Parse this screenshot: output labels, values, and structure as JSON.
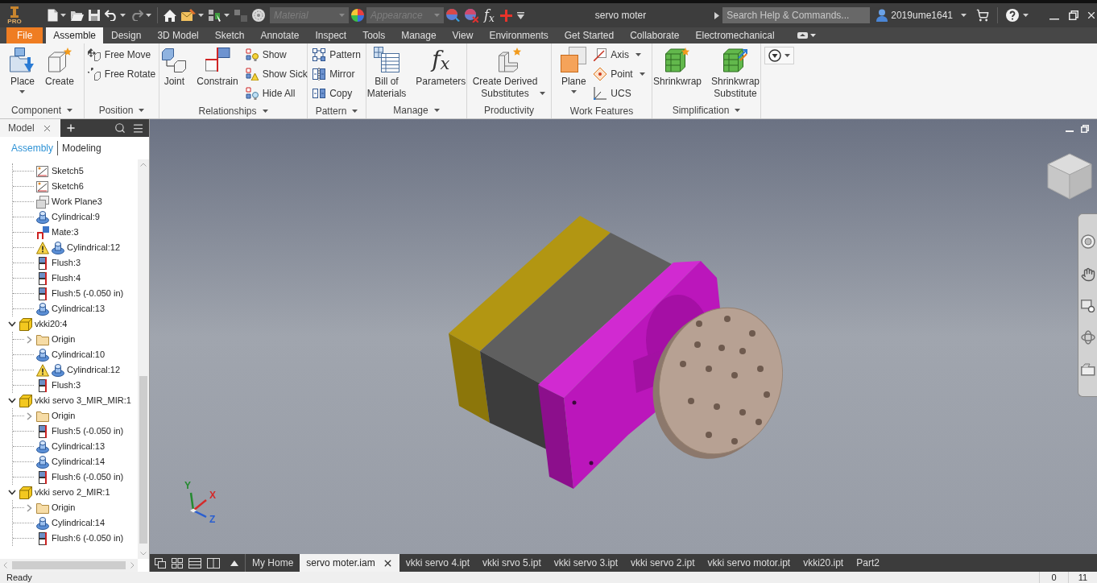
{
  "title_bar": {
    "logo_badge": "PRO",
    "material_field": {
      "placeholder": "Material",
      "disabled": true
    },
    "appearance_field": {
      "placeholder": "Appearance",
      "disabled": true
    },
    "formula_symbol": "f$_{x}$",
    "title": "servo moter",
    "search": {
      "placeholder": "Search Help & Commands..."
    },
    "user": "2019ume1641"
  },
  "ribbon": {
    "tabs": [
      {
        "label": "File",
        "kind": "file",
        "selected": false
      },
      {
        "label": "Assemble",
        "kind": "tab",
        "selected": true
      },
      {
        "label": "Design",
        "kind": "tab",
        "selected": false
      },
      {
        "label": "3D Model",
        "kind": "tab",
        "selected": false
      },
      {
        "label": "Sketch",
        "kind": "tab",
        "selected": false
      },
      {
        "label": "Annotate",
        "kind": "tab",
        "selected": false
      },
      {
        "label": "Inspect",
        "kind": "tab",
        "selected": false
      },
      {
        "label": "Tools",
        "kind": "tab",
        "selected": false
      },
      {
        "label": "Manage",
        "kind": "tab",
        "selected": false
      },
      {
        "label": "View",
        "kind": "tab",
        "selected": false
      },
      {
        "label": "Environments",
        "kind": "tab",
        "selected": false
      },
      {
        "label": "Get Started",
        "kind": "tab",
        "selected": false
      },
      {
        "label": "Collaborate",
        "kind": "tab",
        "selected": false
      },
      {
        "label": "Electromechanical",
        "kind": "tab",
        "selected": false
      }
    ],
    "panels": [
      {
        "title": "Component",
        "has_menu": true,
        "tools": [
          {
            "label": "Place",
            "kind": "large",
            "has_menu": true
          },
          {
            "label": "Create",
            "kind": "large",
            "has_menu": false
          }
        ]
      },
      {
        "title": "Position",
        "has_menu": true,
        "tools": [
          {
            "label": "Free Move",
            "kind": "small",
            "has_menu": false
          },
          {
            "label": "Free Rotate",
            "kind": "small",
            "has_menu": false
          }
        ]
      },
      {
        "title": "Relationships",
        "has_menu": true,
        "tools": [
          {
            "label": "Joint",
            "kind": "large",
            "has_menu": false
          },
          {
            "label": "Constrain",
            "kind": "large",
            "has_menu": false
          },
          {
            "label": "Show",
            "kind": "small",
            "has_menu": false
          },
          {
            "label": "Show Sick",
            "kind": "small",
            "has_menu": false
          },
          {
            "label": "Hide All",
            "kind": "small",
            "has_menu": false
          }
        ]
      },
      {
        "title": "Pattern",
        "has_menu": true,
        "tools": [
          {
            "label": "Pattern",
            "kind": "small",
            "has_menu": false
          },
          {
            "label": "Mirror",
            "kind": "small",
            "has_menu": false
          },
          {
            "label": "Copy",
            "kind": "small",
            "has_menu": false
          }
        ]
      },
      {
        "title": "Manage",
        "has_menu": true,
        "tools": [
          {
            "label": "Bill of\nMaterials",
            "kind": "large",
            "has_menu": false
          },
          {
            "label": "Parameters",
            "kind": "large",
            "has_menu": false,
            "symbol": "f$_{x}$"
          }
        ]
      },
      {
        "title": "Productivity",
        "has_menu": false,
        "tools": [
          {
            "label": "Create Derived\nSubstitutes",
            "kind": "large",
            "has_menu": true
          }
        ]
      },
      {
        "title": "Work Features",
        "has_menu": false,
        "tools": [
          {
            "label": "Plane",
            "kind": "large",
            "has_menu": true
          },
          {
            "label": "Axis",
            "kind": "small",
            "has_menu": true
          },
          {
            "label": "Point",
            "kind": "small",
            "has_menu": true
          },
          {
            "label": "UCS",
            "kind": "small",
            "has_menu": false
          }
        ]
      },
      {
        "title": "Simplification",
        "has_menu": true,
        "tools": [
          {
            "label": "Shrinkwrap",
            "kind": "large",
            "has_menu": false
          },
          {
            "label": "Shrinkwrap\nSubstitute",
            "kind": "large",
            "has_menu": false
          }
        ]
      }
    ]
  },
  "browser": {
    "tabs": [
      {
        "label": "Model",
        "selected": true
      }
    ],
    "modes": [
      {
        "label": "Assembly",
        "selected": true
      },
      {
        "label": "Modeling",
        "selected": false
      }
    ],
    "continued_items": [
      {
        "label": "Sketch5",
        "kind": "sketch",
        "warning": false
      },
      {
        "label": "Sketch6",
        "kind": "sketch",
        "warning": false
      },
      {
        "label": "Work Plane3",
        "kind": "work_plane",
        "warning": false
      },
      {
        "label": "Cylindrical:9",
        "kind": "joint",
        "warning": false
      },
      {
        "label": "Mate:3",
        "kind": "mate",
        "warning": false
      },
      {
        "label": "Cylindrical:12",
        "kind": "joint",
        "warning": true
      },
      {
        "label": "Flush:3",
        "kind": "flush",
        "warning": false
      },
      {
        "label": "Flush:4",
        "kind": "flush",
        "warning": false
      },
      {
        "label": "Flush:5 (-0.050 in)",
        "kind": "flush",
        "warning": false
      },
      {
        "label": "Cylindrical:13",
        "kind": "joint",
        "warning": false
      }
    ],
    "tree": [
      {
        "label": "vkki20:4",
        "kind": "component",
        "expanded": true,
        "children": [
          {
            "label": "Origin",
            "kind": "folder",
            "expanded": false,
            "warning": false
          },
          {
            "label": "Cylindrical:10",
            "kind": "joint",
            "warning": false
          },
          {
            "label": "Cylindrical:12",
            "kind": "joint",
            "warning": true
          },
          {
            "label": "Flush:3",
            "kind": "flush",
            "warning": false
          }
        ]
      },
      {
        "label": "vkki servo 3_MIR_MIR:1",
        "kind": "component",
        "expanded": true,
        "children": [
          {
            "label": "Origin",
            "kind": "folder",
            "expanded": false,
            "warning": false
          },
          {
            "label": "Flush:5 (-0.050 in)",
            "kind": "flush",
            "warning": false
          },
          {
            "label": "Cylindrical:13",
            "kind": "joint",
            "warning": false
          },
          {
            "label": "Cylindrical:14",
            "kind": "joint",
            "warning": false
          },
          {
            "label": "Flush:6 (-0.050 in)",
            "kind": "flush",
            "warning": false
          }
        ]
      },
      {
        "label": "vkki servo 2_MIR:1",
        "kind": "component",
        "expanded": true,
        "children": [
          {
            "label": "Origin",
            "kind": "folder",
            "expanded": false,
            "warning": false
          },
          {
            "label": "Cylindrical:14",
            "kind": "joint",
            "warning": false
          },
          {
            "label": "Flush:6 (-0.050 in)",
            "kind": "flush",
            "warning": false
          }
        ]
      }
    ]
  },
  "viewport": {
    "axis_triad": [
      {
        "label": "Y",
        "color": "#258a30"
      },
      {
        "label": "X",
        "color": "#d42a2a"
      },
      {
        "label": "Z",
        "color": "#2b5fd0"
      }
    ]
  },
  "documents": [
    {
      "label": "My Home",
      "selected": false
    },
    {
      "label": "servo moter.iam",
      "selected": true
    },
    {
      "label": "vkki servo 4.ipt",
      "selected": false
    },
    {
      "label": "vkki srvo 5.ipt",
      "selected": false
    },
    {
      "label": "vkki servo 3.ipt",
      "selected": false
    },
    {
      "label": "vkki servo 2.ipt",
      "selected": false
    },
    {
      "label": "vkki servo motor.ipt",
      "selected": false
    },
    {
      "label": "vkki20.ipt",
      "selected": false
    },
    {
      "label": "Part2",
      "selected": false
    }
  ],
  "status_bar": {
    "text": "Ready",
    "values": [
      "0",
      "11"
    ]
  }
}
